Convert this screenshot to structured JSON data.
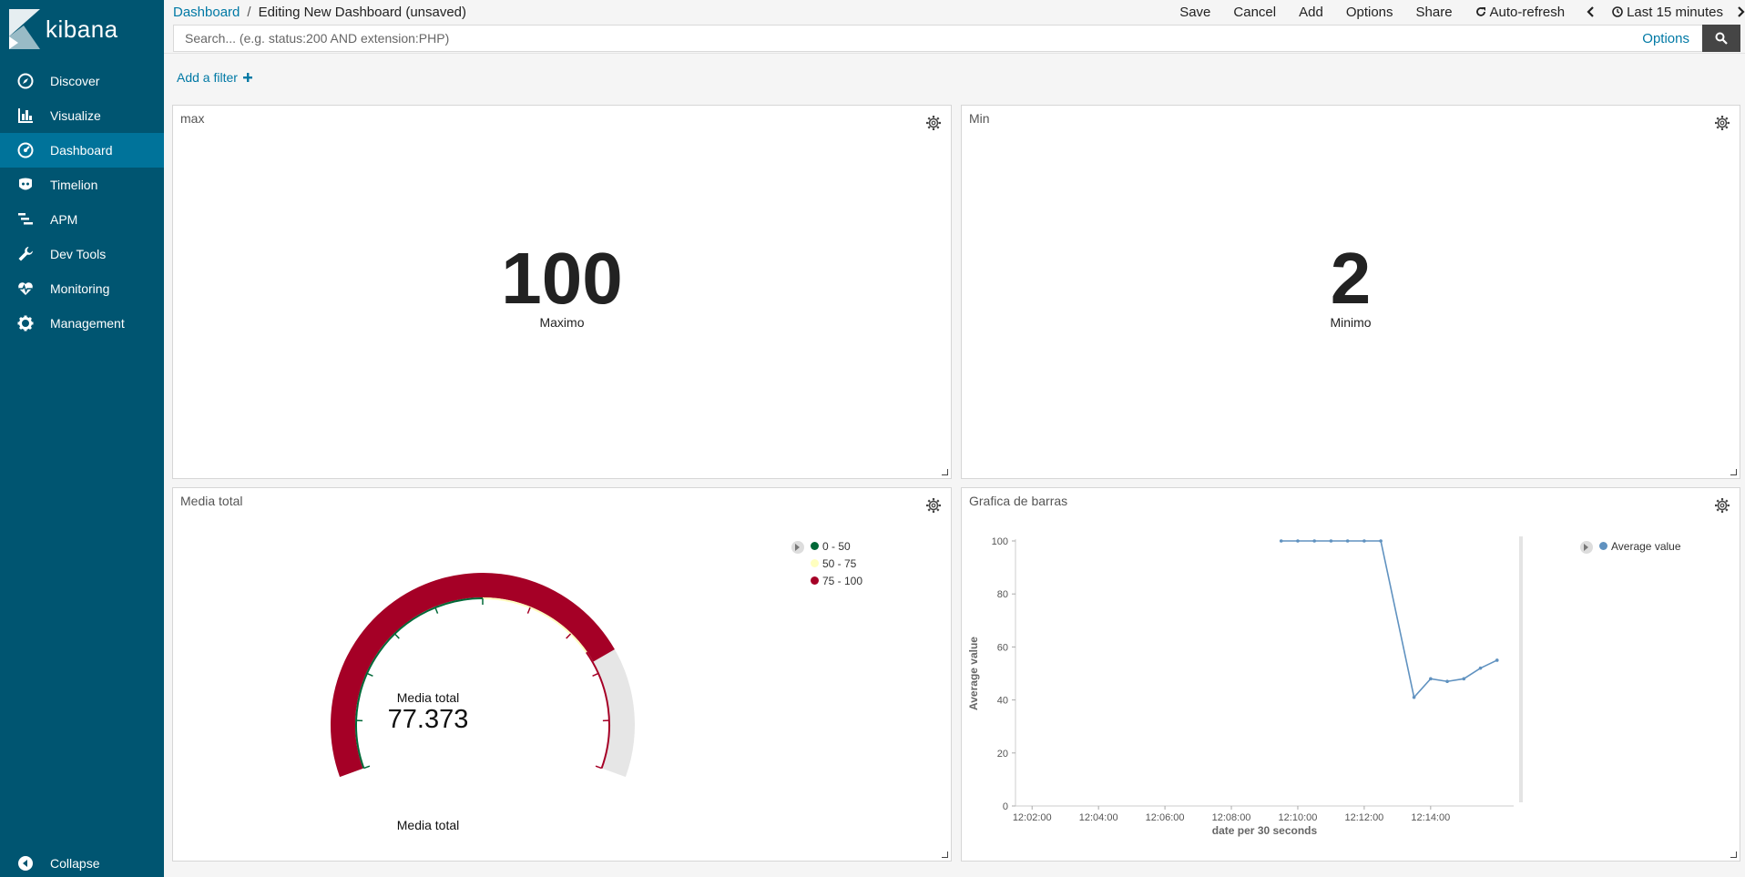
{
  "app": {
    "name": "kibana"
  },
  "sidebar": {
    "items": [
      {
        "label": "Discover",
        "icon": "compass-icon"
      },
      {
        "label": "Visualize",
        "icon": "bar-chart-icon"
      },
      {
        "label": "Dashboard",
        "icon": "dashboard-icon",
        "active": true
      },
      {
        "label": "Timelion",
        "icon": "timelion-icon"
      },
      {
        "label": "APM",
        "icon": "apm-icon"
      },
      {
        "label": "Dev Tools",
        "icon": "wrench-icon"
      },
      {
        "label": "Monitoring",
        "icon": "heartbeat-icon"
      },
      {
        "label": "Management",
        "icon": "gear-icon"
      }
    ],
    "collapse_label": "Collapse"
  },
  "breadcrumb": {
    "root": "Dashboard",
    "separator": "/",
    "current": "Editing New Dashboard (unsaved)"
  },
  "top_menu": {
    "save": "Save",
    "cancel": "Cancel",
    "add": "Add",
    "options": "Options",
    "share": "Share",
    "auto_refresh": "Auto-refresh",
    "time_range": "Last 15 minutes"
  },
  "search": {
    "placeholder": "Search... (e.g. status:200 AND extension:PHP)",
    "value": "",
    "options_label": "Options"
  },
  "filter": {
    "add_label": "Add a filter"
  },
  "panels": {
    "max": {
      "title": "max",
      "value": "100",
      "label": "Maximo"
    },
    "min": {
      "title": "Min",
      "value": "2",
      "label": "Minimo"
    },
    "gauge": {
      "title": "Media total",
      "center_label": "Media total",
      "value": "77.373",
      "value_num": 77.373,
      "bottom_label": "Media total",
      "max": 100,
      "legend": [
        {
          "label": "0 - 50",
          "color": "#006837"
        },
        {
          "label": "50 - 75",
          "color": "#ffffbf"
        },
        {
          "label": "75 - 100",
          "color": "#a50026"
        }
      ]
    },
    "line": {
      "title": "Grafica de barras",
      "legend_label": "Average value",
      "color": "#6092c0"
    }
  },
  "chart_data": {
    "type": "line",
    "title": "Grafica de barras",
    "xlabel": "date per 30 seconds",
    "ylabel": "Average value",
    "ylim": [
      0,
      100
    ],
    "yticks": [
      0,
      20,
      40,
      60,
      80,
      100
    ],
    "xticks": [
      "12:02:00",
      "12:04:00",
      "12:06:00",
      "12:08:00",
      "12:10:00",
      "12:12:00",
      "12:14:00"
    ],
    "xrange": [
      "12:01:30",
      "12:16:30"
    ],
    "series": [
      {
        "name": "Average value",
        "points": [
          [
            "12:09:30",
            100
          ],
          [
            "12:10:00",
            100
          ],
          [
            "12:10:30",
            100
          ],
          [
            "12:11:00",
            100
          ],
          [
            "12:11:30",
            100
          ],
          [
            "12:12:00",
            100
          ],
          [
            "12:12:30",
            100
          ],
          [
            "12:13:30",
            41
          ],
          [
            "12:14:00",
            48
          ],
          [
            "12:14:30",
            47
          ],
          [
            "12:15:00",
            48
          ],
          [
            "12:15:30",
            52
          ],
          [
            "12:16:00",
            55
          ]
        ]
      }
    ],
    "legend_position": "top-right"
  }
}
